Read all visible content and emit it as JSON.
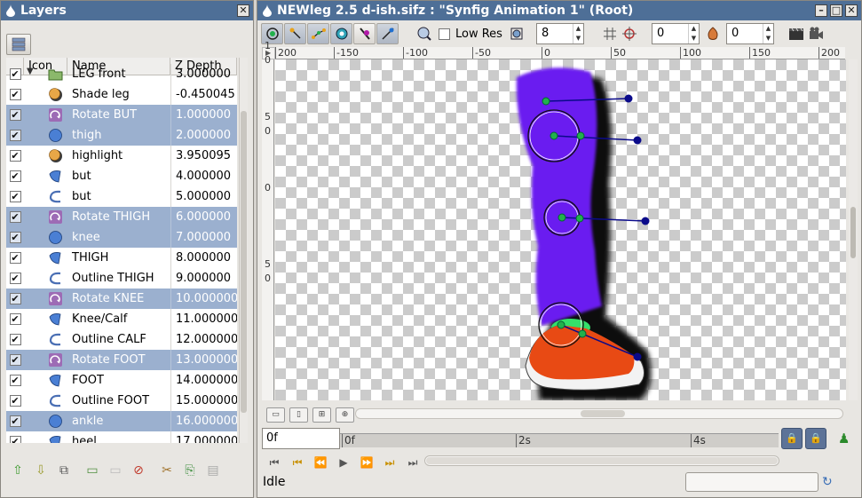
{
  "layers_panel": {
    "title": "Layers",
    "columns": [
      "Icon",
      "Name",
      "Z Depth"
    ],
    "rows": [
      {
        "name": "LEG front",
        "z": "3.000000",
        "icon": "folder-icon",
        "selected": false,
        "expander": "▼"
      },
      {
        "name": "Shade leg",
        "z": "-0.450045",
        "icon": "shade-icon",
        "selected": false,
        "expander": ""
      },
      {
        "name": "Rotate BUT",
        "z": "1.000000",
        "icon": "rotate-icon",
        "selected": true,
        "expander": ""
      },
      {
        "name": "thigh",
        "z": "2.000000",
        "icon": "circle-icon",
        "selected": true,
        "expander": ""
      },
      {
        "name": "highlight",
        "z": "3.950095",
        "icon": "shade-icon",
        "selected": false,
        "expander": ""
      },
      {
        "name": "but",
        "z": "4.000000",
        "icon": "region-icon",
        "selected": false,
        "expander": ""
      },
      {
        "name": "but",
        "z": "5.000000",
        "icon": "outline-icon",
        "selected": false,
        "expander": ""
      },
      {
        "name": "Rotate THIGH",
        "z": "6.000000",
        "icon": "rotate-icon",
        "selected": true,
        "expander": ""
      },
      {
        "name": "knee",
        "z": "7.000000",
        "icon": "circle-icon",
        "selected": true,
        "expander": ""
      },
      {
        "name": "THIGH",
        "z": "8.000000",
        "icon": "region-icon",
        "selected": false,
        "expander": ""
      },
      {
        "name": "Outline THIGH",
        "z": "9.000000",
        "icon": "outline-icon",
        "selected": false,
        "expander": ""
      },
      {
        "name": "Rotate KNEE",
        "z": "10.000000",
        "icon": "rotate-icon",
        "selected": true,
        "expander": ""
      },
      {
        "name": "Knee/Calf",
        "z": "11.000000",
        "icon": "region-icon",
        "selected": false,
        "expander": ""
      },
      {
        "name": "Outline CALF",
        "z": "12.000000",
        "icon": "outline-icon",
        "selected": false,
        "expander": ""
      },
      {
        "name": "Rotate FOOT",
        "z": "13.000000",
        "icon": "rotate-icon",
        "selected": true,
        "expander": ""
      },
      {
        "name": "FOOT",
        "z": "14.000000",
        "icon": "region-icon",
        "selected": false,
        "expander": ""
      },
      {
        "name": "Outline FOOT",
        "z": "15.000000",
        "icon": "outline-icon",
        "selected": false,
        "expander": ""
      },
      {
        "name": "ankle",
        "z": "16.000000",
        "icon": "circle-icon",
        "selected": true,
        "expander": ""
      },
      {
        "name": "heel",
        "z": "17.000000",
        "icon": "region-icon",
        "selected": false,
        "expander": ""
      }
    ],
    "check_mark": "✔",
    "bottom_buttons": [
      {
        "name": "raise-layer-button",
        "glyph": "⇧"
      },
      {
        "name": "lower-layer-button",
        "glyph": "⇩"
      },
      {
        "name": "duplicate-layer-button",
        "glyph": "⧉"
      },
      {
        "name": "group-layer-button",
        "glyph": "▭"
      },
      {
        "name": "ungroup-layer-button",
        "glyph": "▭"
      },
      {
        "name": "delete-layer-button",
        "glyph": "⊘"
      },
      {
        "name": "cut-layer-button",
        "glyph": "✂"
      },
      {
        "name": "copy-layer-button",
        "glyph": "⎘"
      },
      {
        "name": "paste-layer-button",
        "glyph": "▤"
      }
    ]
  },
  "main_window": {
    "title": "NEWleg 2.5 d-ish.sifz : \"Synfig Animation 1\" (Root)",
    "low_res_label": "Low Res",
    "quality_value": "8",
    "onion_past": "0",
    "onion_future": "0",
    "ruler_h": [
      "200",
      "-150",
      "-100",
      "-50",
      "0",
      "50",
      "100",
      "150",
      "200"
    ],
    "ruler_v": [
      "1",
      "0",
      "5",
      "0",
      "0",
      "5",
      "0"
    ],
    "current_frame": "0f",
    "time_ticks": [
      "0f",
      "2s",
      "4s"
    ],
    "status": "Idle"
  },
  "colors": {
    "titlebar": "#4e6f97",
    "selection": "#9bb0cf",
    "leg": "#6a1ef0",
    "shoe": "#e84a14",
    "duck_green": "#22b14c",
    "duck_blue": "#0a0a8a"
  }
}
